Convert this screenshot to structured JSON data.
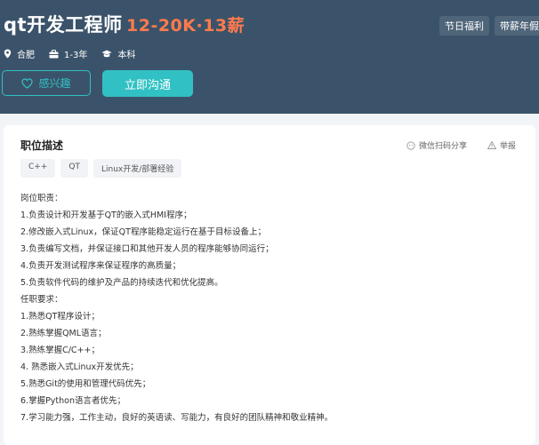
{
  "header": {
    "title": "qt开发工程师",
    "salary": "12-20K·13薪",
    "tags": [
      "节日福利",
      "带薪年假"
    ],
    "meta": {
      "location": "合肥",
      "experience": "1-3年",
      "education": "本科"
    },
    "interest_label": "感兴趣",
    "chat_label": "立即沟通"
  },
  "section": {
    "title": "职位描述",
    "share_label": "微信扫码分享",
    "report_label": "举报",
    "skills": [
      "C++",
      "QT",
      "Linux开发/部署经验"
    ]
  },
  "description": [
    "岗位职责：",
    "1.负责设计和开发基于QT的嵌入式HMI程序；",
    "2.修改嵌入式Linux，保证QT程序能稳定运行在基于目标设备上；",
    "3.负责编写文档，并保证接口和其他开发人员的程序能够协同运行；",
    "4.负责开发测试程序来保证程序的高质量；",
    "5.负责软件代码的维护及产品的持续迭代和优化提高。",
    "任职要求：",
    "1.熟悉QT程序设计；",
    "2.熟练掌握QML语言；",
    "3.熟练掌握C/C++；",
    "4. 熟悉嵌入式Linux开发优先；",
    "5.熟悉Git的使用和管理代码优先；",
    "6.掌握Python语言者优先；",
    "7.学习能力强，工作主动，良好的英语读、写能力，有良好的团队精神和敬业精神。"
  ],
  "colors": {
    "header_bg": "#3b536a",
    "salary": "#ff7a4d",
    "accent": "#31c1c4"
  }
}
